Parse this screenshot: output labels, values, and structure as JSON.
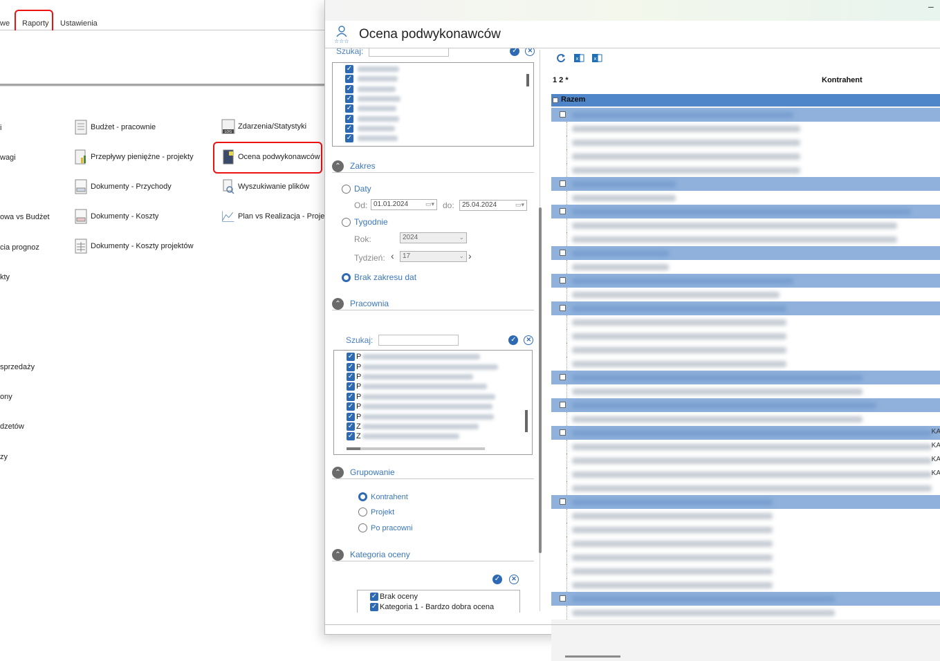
{
  "background_app": {
    "tabs": [
      "we",
      "Raporty",
      "Ustawienia"
    ],
    "left_truncated": [
      "i",
      "wagi",
      "owa vs Budżet",
      "cia prognoz",
      "kty",
      "sprzedaży",
      "ony",
      "dzetów",
      "zy"
    ],
    "col1": [
      {
        "label": "Budżet - pracownie",
        "icon": "budget-report-icon"
      },
      {
        "label": "Przepływy pieniężne - projekty",
        "icon": "cashflow-report-icon"
      },
      {
        "label": "Dokumenty - Przychody",
        "icon": "income-document-icon"
      },
      {
        "label": "Dokumenty - Koszty",
        "icon": "cost-document-icon"
      },
      {
        "label": "Dokumenty - Koszty projektów",
        "icon": "project-costs-document-icon"
      }
    ],
    "col2": [
      {
        "label": "Zdarzenia/Statystyki",
        "icon": "log-icon",
        "icon_text": "LOG"
      },
      {
        "label": "Ocena podwykonawców",
        "icon": "subcontractor-rating-icon"
      },
      {
        "label": "Wyszukiwanie plików",
        "icon": "file-search-icon"
      },
      {
        "label": "Plan vs Realizacja - Projek",
        "icon": "plan-vs-realization-icon"
      }
    ]
  },
  "dialog": {
    "title": "Ocena podwykonawców",
    "minimize": "–",
    "left": {
      "top_search_label": "Szukaj:",
      "sections": {
        "zakres": "Zakres",
        "pracownia": "Pracownia",
        "grupowanie": "Grupowanie",
        "kategoria": "Kategoria oceny"
      },
      "zakres": {
        "daty": "Daty",
        "od_label": "Od:",
        "od_value": "01.01.2024",
        "do_label": "do:",
        "do_value": "25.04.2024",
        "tygodnie": "Tygodnie",
        "rok_label": "Rok:",
        "rok_value": "2024",
        "tydzien_label": "Tydzień:",
        "tydzien_value": "17",
        "brak": "Brak zakresu dat"
      },
      "pracownia_search_label": "Szukaj:",
      "pracownia_prefixes": [
        "P",
        "P",
        "P",
        "P",
        "P",
        "P",
        "P",
        "Z",
        "Z"
      ],
      "grupowanie": {
        "options": [
          "Kontrahent",
          "Projekt",
          "Po pracowni"
        ],
        "selected": "Kontrahent"
      },
      "kategoria_items": [
        "Brak oceny",
        "Kategoria 1 - Bardzo dobra ocena"
      ]
    },
    "right": {
      "grid_levels": "1 2 *",
      "column_header": "Kontrahent",
      "razem": "Razem",
      "right_edge_chars": [
        "KA",
        "KA",
        "KA",
        "KA"
      ]
    }
  }
}
